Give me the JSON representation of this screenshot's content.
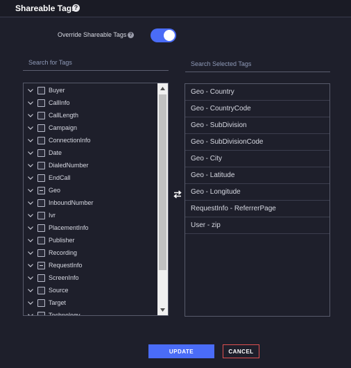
{
  "header": {
    "title": "Shareable Tags",
    "help_icon": "question-circle-icon"
  },
  "override": {
    "label": "Override Shareable Tags",
    "help_icon": "question-circle-icon",
    "enabled": true,
    "accent": "#4a6cf7"
  },
  "search_tags": {
    "placeholder": "Search for Tags"
  },
  "search_selected": {
    "placeholder": "Search Selected Tags"
  },
  "tags": {
    "items": [
      {
        "label": "Buyer",
        "state": "unchecked"
      },
      {
        "label": "CallInfo",
        "state": "unchecked"
      },
      {
        "label": "CallLength",
        "state": "unchecked"
      },
      {
        "label": "Campaign",
        "state": "unchecked"
      },
      {
        "label": "ConnectionInfo",
        "state": "unchecked"
      },
      {
        "label": "Date",
        "state": "unchecked"
      },
      {
        "label": "DialedNumber",
        "state": "unchecked"
      },
      {
        "label": "EndCall",
        "state": "unchecked"
      },
      {
        "label": "Geo",
        "state": "partial"
      },
      {
        "label": "InboundNumber",
        "state": "unchecked"
      },
      {
        "label": "Ivr",
        "state": "unchecked"
      },
      {
        "label": "PlacementInfo",
        "state": "unchecked"
      },
      {
        "label": "Publisher",
        "state": "unchecked"
      },
      {
        "label": "Recording",
        "state": "unchecked"
      },
      {
        "label": "RequestInfo",
        "state": "partial"
      },
      {
        "label": "ScreenInfo",
        "state": "unchecked"
      },
      {
        "label": "Source",
        "state": "unchecked"
      },
      {
        "label": "Target",
        "state": "unchecked"
      },
      {
        "label": "Technology",
        "state": "unchecked"
      }
    ],
    "expand_icon": "chevron-down-icon"
  },
  "swap_icon": "swap-arrows-icon",
  "selected": {
    "items": [
      "Geo - Country",
      "Geo - CountryCode",
      "Geo - SubDivision",
      "Geo - SubDivisionCode",
      "Geo - City",
      "Geo - Latitude",
      "Geo - Longitude",
      "RequestInfo - ReferrerPage",
      "User - zip"
    ]
  },
  "buttons": {
    "update": "UPDATE",
    "cancel": "CANCEL",
    "cancel_border": "#e05050"
  }
}
